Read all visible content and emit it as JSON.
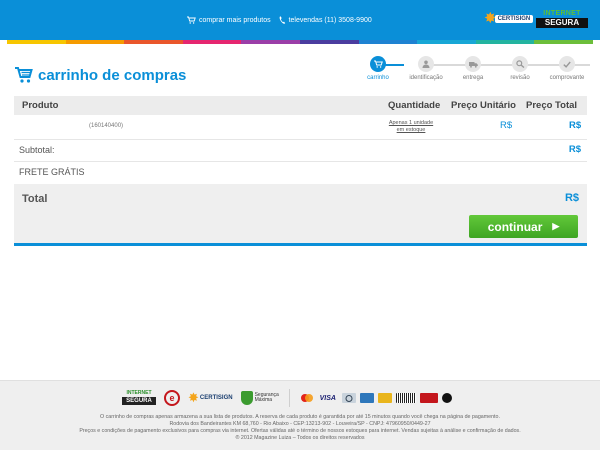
{
  "header": {
    "links": [
      {
        "icon": "cart-icon",
        "label": "comprar mais produtos"
      },
      {
        "icon": "phone-icon",
        "label": "televendas (11) 3508-9900"
      }
    ],
    "certisign": "CERTISIGN",
    "internet_segura": {
      "top": "INTERNET",
      "bottom": "SEGURA"
    }
  },
  "colors": {
    "primary": "#0a8fd8",
    "green": "#4cb82c",
    "stripe": [
      "#f7c600",
      "#f59b00",
      "#e9562b",
      "#e5266f",
      "#9b3ea8",
      "#4b3d9f",
      "#1e82d2",
      "#18a7d6",
      "#23b4a0",
      "#6cbe3a"
    ]
  },
  "page": {
    "title": "carrinho de compras"
  },
  "steps": [
    {
      "label": "carrinho",
      "icon": "cart-icon",
      "active": true
    },
    {
      "label": "identificação",
      "icon": "user-icon",
      "active": false
    },
    {
      "label": "entrega",
      "icon": "truck-icon",
      "active": false
    },
    {
      "label": "revisão",
      "icon": "search-icon",
      "active": false
    },
    {
      "label": "comprovante",
      "icon": "check-icon",
      "active": false
    }
  ],
  "table": {
    "headers": {
      "product": "Produto",
      "quantity": "Quantidade",
      "unit_price": "Preço Unitário",
      "total_price": "Preço Total"
    },
    "rows": [
      {
        "code": "(160140400)",
        "quantity": "Apenas 1 unidade em estoque",
        "unit_price": "R$",
        "total_price": "R$"
      }
    ]
  },
  "summary": {
    "subtotal_label": "Subtotal:",
    "subtotal_value": "R$",
    "shipping_label": "FRETE GRÁTIS",
    "total_label": "Total",
    "total_value": "R$"
  },
  "continue_button": {
    "label": "continuar",
    "icon": "chevron-right-icon"
  },
  "footer": {
    "seals": {
      "internet_segura_top": "INTERNET",
      "internet_segura_bottom": "SEGURA",
      "e_seal": "e",
      "certisign": "CERTISIGN",
      "seguranca": "Segurança",
      "maxima": "Máxima"
    },
    "payments": [
      "mastercard",
      "VISA",
      "diners",
      "amex",
      "hipercard",
      "boleto",
      "hipercard-red",
      "elo"
    ],
    "lines": [
      "O carrinho de compras apenas armazena a sua lista de produtos. A reserva de cada produto é garantida por até 15 minutos quando você chega na página de pagamento.",
      "Rodovia dos Bandeirantes KM 68,760 - Rio Abaixo - CEP:13213-902 - Louveira/SP - CNPJ: 47960950/0449-27",
      "Preços e condições de pagamento exclusivos para compras via internet. Ofertas válidas até o término de nossos estoques para internet. Vendas sujeitas à análise e confirmação de dados.",
      "® 2012 Magazine Luiza – Todos os direitos reservados"
    ]
  }
}
